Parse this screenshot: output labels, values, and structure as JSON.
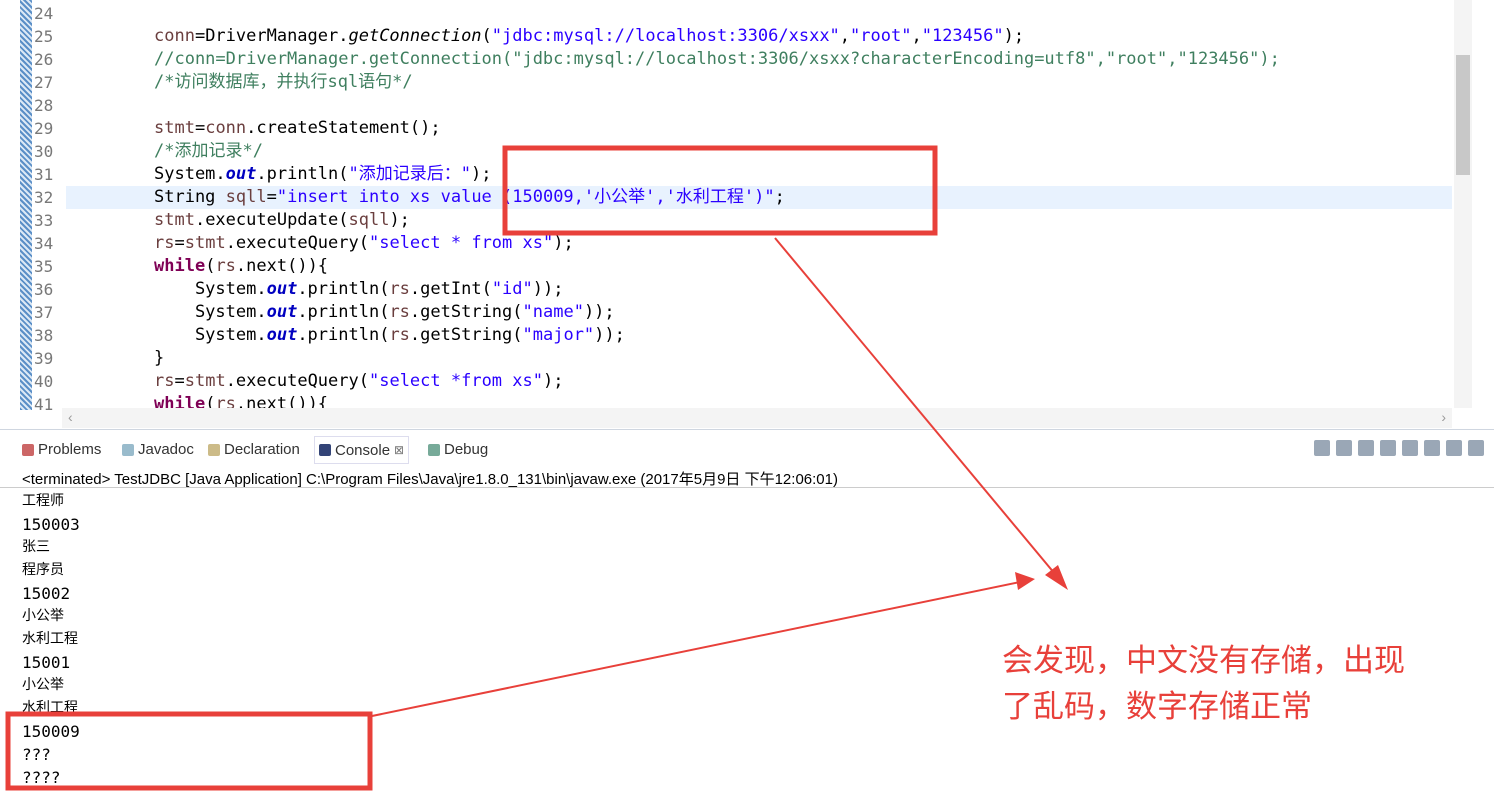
{
  "editor": {
    "lines": [
      {
        "n": "24",
        "segs": []
      },
      {
        "n": "25",
        "segs": [
          [
            "conn",
            "var"
          ],
          [
            "=DriverManager.",
            ""
          ],
          [
            "getConnection",
            "it"
          ],
          [
            "(",
            ""
          ],
          [
            "\"jdbc:mysql://localhost:3306/xsxx\"",
            "str"
          ],
          [
            ",",
            ""
          ],
          [
            "\"root\"",
            "str"
          ],
          [
            ",",
            ""
          ],
          [
            "\"123456\"",
            "str"
          ],
          [
            ");",
            ""
          ]
        ]
      },
      {
        "n": "26",
        "segs": [
          [
            "//conn=DriverManager.getConnection(\"jdbc:mysql://localhost:3306/xsxx?characterEncoding=utf8\",\"root\",\"123456\");",
            "cm"
          ]
        ]
      },
      {
        "n": "27",
        "segs": [
          [
            "/*访问数据库，并执行sql语句*/",
            "cm"
          ]
        ]
      },
      {
        "n": "28",
        "segs": []
      },
      {
        "n": "29",
        "segs": [
          [
            "stmt",
            "var"
          ],
          [
            "=",
            ""
          ],
          [
            "conn",
            "var"
          ],
          [
            ".createStatement();",
            ""
          ]
        ]
      },
      {
        "n": "30",
        "segs": [
          [
            "/*添加记录*/",
            "cm"
          ]
        ]
      },
      {
        "n": "31",
        "segs": [
          [
            "System.",
            ""
          ],
          [
            "out",
            "fld"
          ],
          [
            ".println(",
            ""
          ],
          [
            "\"添加记录后：\"",
            "str"
          ],
          [
            ");",
            ""
          ]
        ]
      },
      {
        "n": "32",
        "segs": [
          [
            "String ",
            ""
          ],
          [
            "sqll",
            "var"
          ],
          [
            "=",
            ""
          ],
          [
            "\"insert into xs value (150009,'小公举','水利工程')\"",
            "str"
          ],
          [
            ";",
            ""
          ]
        ]
      },
      {
        "n": "33",
        "segs": [
          [
            "stmt",
            "var"
          ],
          [
            ".executeUpdate(",
            ""
          ],
          [
            "sqll",
            "var"
          ],
          [
            ");",
            ""
          ]
        ]
      },
      {
        "n": "34",
        "segs": [
          [
            "rs",
            "var"
          ],
          [
            "=",
            ""
          ],
          [
            "stmt",
            "var"
          ],
          [
            ".executeQuery(",
            ""
          ],
          [
            "\"select * from xs\"",
            "str"
          ],
          [
            ");",
            ""
          ]
        ]
      },
      {
        "n": "35",
        "segs": [
          [
            "while",
            "kw"
          ],
          [
            "(",
            ""
          ],
          [
            "rs",
            "var"
          ],
          [
            ".next()){",
            ""
          ]
        ]
      },
      {
        "n": "36",
        "segs": [
          [
            "    System.",
            ""
          ],
          [
            "out",
            "fld"
          ],
          [
            ".println(",
            ""
          ],
          [
            "rs",
            "var"
          ],
          [
            ".getInt(",
            ""
          ],
          [
            "\"id\"",
            "str"
          ],
          [
            "));",
            ""
          ]
        ]
      },
      {
        "n": "37",
        "segs": [
          [
            "    System.",
            ""
          ],
          [
            "out",
            "fld"
          ],
          [
            ".println(",
            ""
          ],
          [
            "rs",
            "var"
          ],
          [
            ".getString(",
            ""
          ],
          [
            "\"name\"",
            "str"
          ],
          [
            "));",
            ""
          ]
        ]
      },
      {
        "n": "38",
        "segs": [
          [
            "    System.",
            ""
          ],
          [
            "out",
            "fld"
          ],
          [
            ".println(",
            ""
          ],
          [
            "rs",
            "var"
          ],
          [
            ".getString(",
            ""
          ],
          [
            "\"major\"",
            "str"
          ],
          [
            "));",
            ""
          ]
        ]
      },
      {
        "n": "39",
        "segs": [
          [
            "}",
            ""
          ]
        ]
      },
      {
        "n": "40",
        "segs": [
          [
            "rs",
            "var"
          ],
          [
            "=",
            ""
          ],
          [
            "stmt",
            "var"
          ],
          [
            ".executeQuery(",
            ""
          ],
          [
            "\"select *from xs\"",
            "str"
          ],
          [
            ");",
            ""
          ]
        ]
      },
      {
        "n": "41",
        "segs": [
          [
            "while",
            "kw"
          ],
          [
            "(",
            ""
          ],
          [
            "rs",
            "var"
          ],
          [
            ".next()){",
            ""
          ]
        ]
      }
    ],
    "highlight_line": "32"
  },
  "tabs": [
    {
      "label": "Problems",
      "icon": "problems-icon"
    },
    {
      "label": "Javadoc",
      "icon": "javadoc-icon"
    },
    {
      "label": "Declaration",
      "icon": "declaration-icon"
    },
    {
      "label": "Console",
      "icon": "console-icon",
      "active": true,
      "close": "⊠"
    },
    {
      "label": "Debug",
      "icon": "debug-icon"
    }
  ],
  "console": {
    "status": "<terminated> TestJDBC [Java Application] C:\\Program Files\\Java\\jre1.8.0_131\\bin\\javaw.exe (2017年5月9日 下午12:06:01)",
    "output": [
      "工程师",
      "150003",
      "张三",
      "程序员",
      "15002",
      "小公举",
      "水利工程",
      "15001",
      "小公举",
      "水利工程",
      "150009",
      "???",
      "????"
    ]
  },
  "annotation": {
    "text_line1": "会发现，中文没有存储，出现",
    "text_line2": "了乱码，数字存储正常",
    "color": "#e8403a"
  }
}
